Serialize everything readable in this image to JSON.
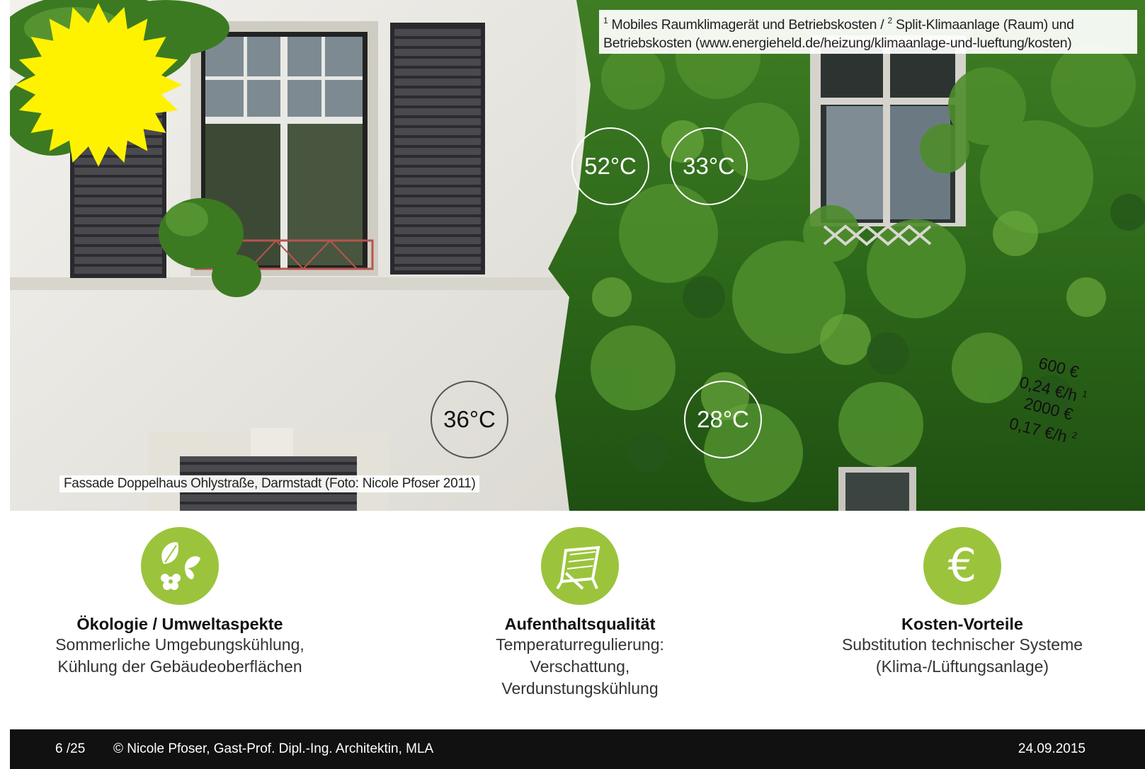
{
  "footnote": {
    "ref1": "1",
    "text1": "Mobiles Raumklimagerät und Betriebskosten /",
    "ref2": "2",
    "text2": "Split-Klimaanlage (Raum) und Betriebskosten (www.energieheld.de/heizung/klimaanlage-und-lueftung/kosten)"
  },
  "caption": "Fassade Doppelhaus Ohlystraße, Darmstadt (Foto: Nicole Pfoser 2011)",
  "temperatures": {
    "t1": "52°C",
    "t2": "33°C",
    "t3": "36°C",
    "t4": "28°C"
  },
  "burst": {
    "line1": "600 €",
    "line2": "0,24 €/h",
    "ref1": "1",
    "line3": "2000 €",
    "line4": "0,17 €/h",
    "ref2": "2",
    "color": "#fff200"
  },
  "features": [
    {
      "icon": "leaf-butterfly-flower-icon",
      "title": "Ökologie / Umweltaspekte",
      "line1": "Sommerliche Umgebungskühlung,",
      "line2": "Kühlung der Gebäudeoberflächen"
    },
    {
      "icon": "deck-chair-icon",
      "title": "Aufenthaltsqualität",
      "line1": "Temperaturregulierung:",
      "line2": "Verschattung,",
      "line3": "Verdunstungskühlung"
    },
    {
      "icon": "euro-icon",
      "symbol": "€",
      "title": "Kosten-Vorteile",
      "line1": "Substitution technischer Systeme",
      "line2": "(Klima-/Lüftungsanlage)"
    }
  ],
  "accent_color": "#9bc43c",
  "footer": {
    "page": "6 /25",
    "author": "© Nicole Pfoser, Gast-Prof. Dipl.-Ing. Architektin, MLA",
    "date": "24.09.2015"
  }
}
